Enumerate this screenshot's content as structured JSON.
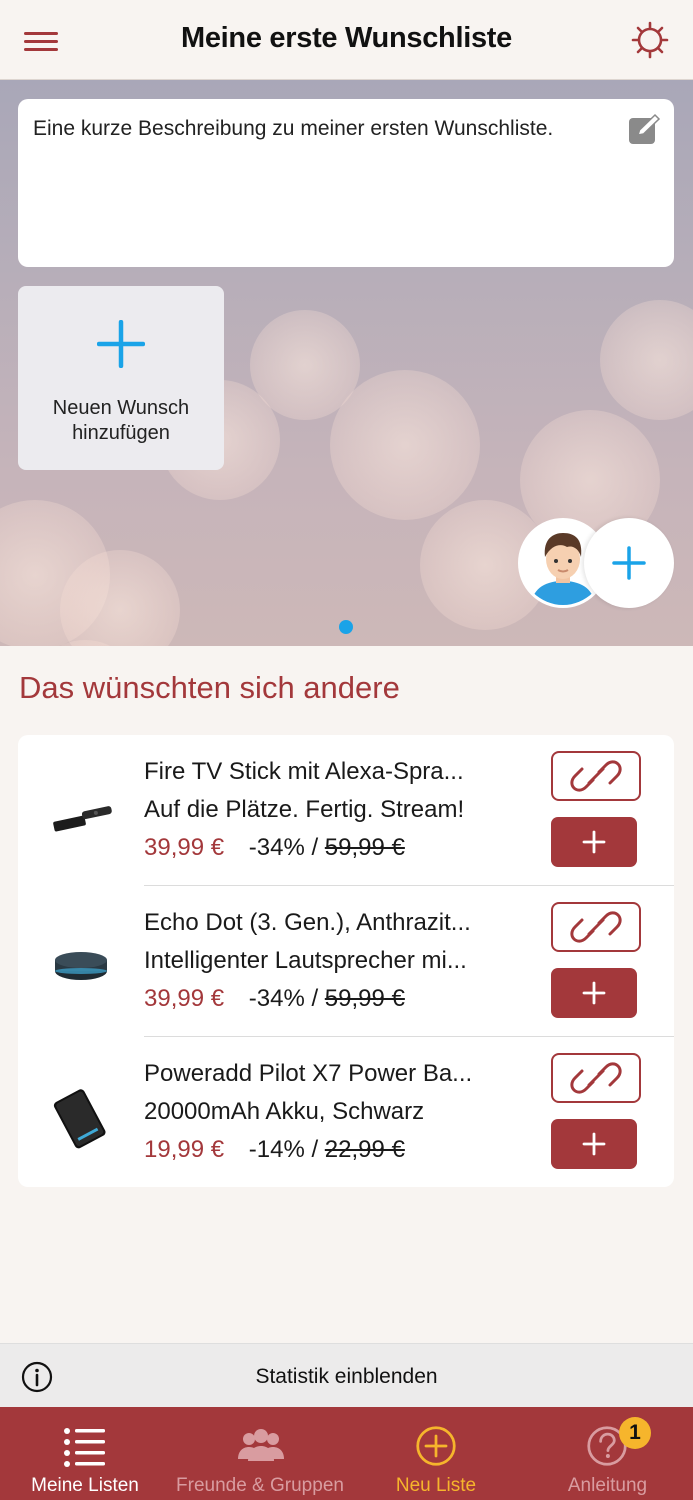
{
  "header": {
    "title": "Meine erste Wunschliste",
    "menu_icon": "hamburger-menu-icon",
    "settings_icon": "gear-icon"
  },
  "hero": {
    "description": "Eine kurze Beschreibung zu meiner ersten Wunschliste.",
    "edit_icon": "pencil-edit-icon",
    "add_wish_label": "Neuen Wunsch hinzufügen",
    "add_wish_icon": "plus-icon",
    "share_icon": "plus-icon",
    "page_indicator": {
      "pages": 1,
      "current": 1
    }
  },
  "section": {
    "title": "Das wünschten sich andere"
  },
  "products": [
    {
      "title": "Fire TV Stick mit Alexa-Spra...",
      "subtitle": "Auf die Plätze. Fertig. Stream!",
      "price": "39,99 €",
      "discount": "-34% /",
      "old_price": "59,99 €"
    },
    {
      "title": "Echo Dot (3. Gen.), Anthrazit...",
      "subtitle": "Intelligenter Lautsprecher mi...",
      "price": "39,99 €",
      "discount": "-34% /",
      "old_price": "59,99 €"
    },
    {
      "title": "Poweradd Pilot X7 Power Ba...",
      "subtitle": "20000mAh Akku, Schwarz",
      "price": "19,99 €",
      "discount": "-14% /",
      "old_price": "22,99 €"
    }
  ],
  "stats": {
    "label": "Statistik einblenden",
    "icon": "info-icon"
  },
  "tabbar": {
    "tabs": [
      {
        "label": "Meine Listen",
        "icon": "list-icon"
      },
      {
        "label": "Freunde & Gruppen",
        "icon": "people-icon"
      },
      {
        "label": "Neu Liste",
        "icon": "plus-circle-icon"
      },
      {
        "label": "Anleitung",
        "icon": "help-circle-icon"
      }
    ],
    "badge_count": "1"
  },
  "colors": {
    "accent": "#a3383b",
    "link_blue": "#1aa3e8",
    "active_tab": "#ffffff",
    "inactive_tab": "#d99ca0",
    "highlight_tab": "#f6b52c",
    "background": "#f8f4f1"
  }
}
